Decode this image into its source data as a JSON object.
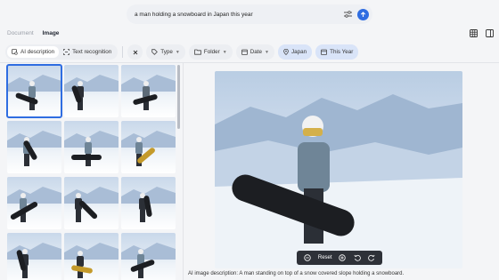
{
  "search": {
    "query": "a man holding a snowboard in Japan this year"
  },
  "tabs": [
    {
      "label": "Document"
    },
    {
      "label": "Image"
    }
  ],
  "filters": {
    "ai_description": "AI description",
    "text_recognition": "Text recognition",
    "type": "Type",
    "folder": "Folder",
    "date": "Date",
    "location": "Japan",
    "period": "This Year"
  },
  "viewer": {
    "reset_label": "Reset",
    "description": "AI image description: A man standing on top of a snow covered slope holding a snowboard."
  },
  "colors": {
    "accent": "#2f6de1",
    "chip_selected": "#d9e4f8"
  }
}
